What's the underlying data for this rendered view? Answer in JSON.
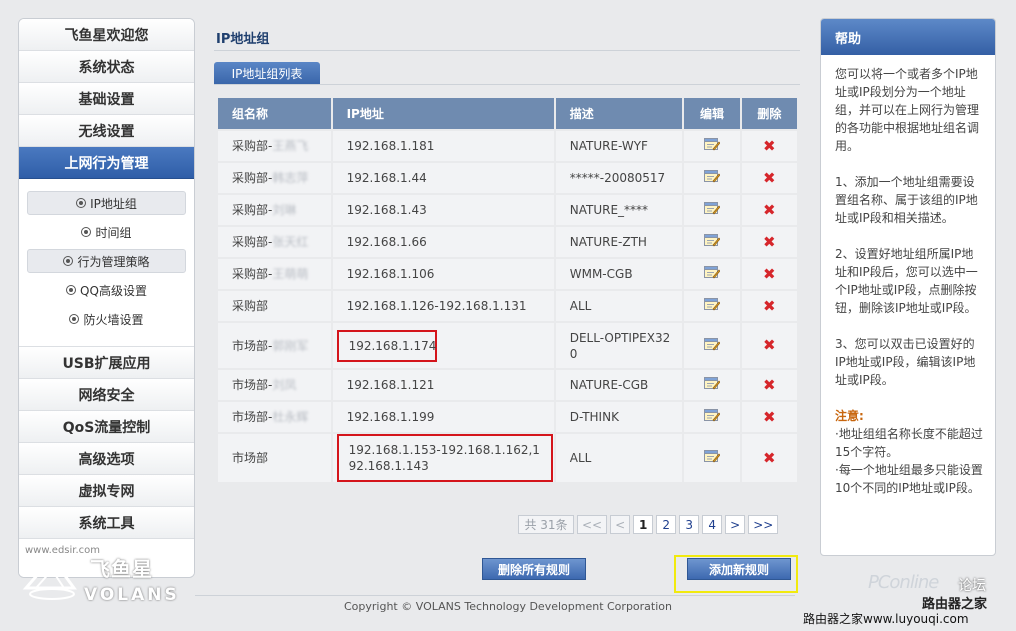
{
  "sidebar": {
    "items_top": [
      {
        "label": "飞鱼星欢迎您"
      },
      {
        "label": "系统状态"
      },
      {
        "label": "基础设置"
      },
      {
        "label": "无线设置"
      },
      {
        "label": "上网行为管理"
      }
    ],
    "submenu": [
      {
        "label": "IP地址组"
      },
      {
        "label": "时间组"
      },
      {
        "label": "行为管理策略"
      },
      {
        "label": "QQ高级设置"
      },
      {
        "label": "防火墙设置"
      }
    ],
    "items_bottom": [
      {
        "label": "USB扩展应用"
      },
      {
        "label": "网络安全"
      },
      {
        "label": "QoS流量控制"
      },
      {
        "label": "高级选项"
      },
      {
        "label": "虚拟专网"
      },
      {
        "label": "系统工具"
      }
    ],
    "footer_watermark": "www.edsir.com",
    "logo_text": "飞鱼星",
    "logo_sub": "VOLANS"
  },
  "main": {
    "title": "IP地址组",
    "tab": "IP地址组列表",
    "columns": [
      "组名称",
      "IP地址",
      "描述",
      "编辑",
      "删除"
    ],
    "rows": [
      {
        "name": "采购部-",
        "blurred": "王燕飞",
        "ip": "192.168.1.181",
        "desc": "NATURE-WYF"
      },
      {
        "name": "采购部-",
        "blurred": "韩志萍",
        "ip": "192.168.1.44",
        "desc": "*****-20080517"
      },
      {
        "name": "采购部-",
        "blurred": "刘琳",
        "ip": "192.168.1.43",
        "desc": "NATURE_****"
      },
      {
        "name": "采购部-",
        "blurred": "张天红",
        "ip": "192.168.1.66",
        "desc": "NATURE-ZTH"
      },
      {
        "name": "采购部-",
        "blurred": "王萌萌",
        "ip": "192.168.1.106",
        "desc": "WMM-CGB"
      },
      {
        "name": "采购部",
        "blurred": "",
        "ip": "192.168.1.126-192.168.1.131",
        "desc": "ALL"
      },
      {
        "name": "市场部-",
        "blurred": "郭刚军",
        "ip": "192.168.1.174",
        "desc": "DELL-OPTIPEX320"
      },
      {
        "name": "市场部-",
        "blurred": "刘凤",
        "ip": "192.168.1.121",
        "desc": "NATURE-CGB"
      },
      {
        "name": "市场部-",
        "blurred": "杜永辉",
        "ip": "192.168.1.199",
        "desc": "D-THINK"
      },
      {
        "name": "市场部",
        "blurred": "",
        "ip": "192.168.1.153-192.168.1.162,192.168.1.143",
        "desc": "ALL"
      }
    ],
    "pager": {
      "total": "共 31条",
      "first": "<<",
      "prev": "<",
      "pages": [
        "1",
        "2",
        "3",
        "4"
      ],
      "next": ">",
      "last": ">>"
    },
    "delete_all": "删除所有规则",
    "add_new": "添加新规则",
    "copyright": "Copyright © VOLANS Technology Development Corporation"
  },
  "help": {
    "title": "帮助",
    "paragraphs": [
      "您可以将一个或者多个IP地址或IP段划分为一个地址组，并可以在上网行为管理的各功能中根据地址组名调用。",
      "1、添加一个地址组需要设置组名称、属于该组的IP地址或IP段和相关描述。",
      "2、设置好地址组所属IP地址和IP段后，您可以选中一个IP地址或IP段，点删除按钮，删除该IP地址或IP段。",
      "3、您可以双击已设置好的IP地址或IP段，编辑该IP地址或IP段。"
    ],
    "note_title": "注意:",
    "notes": [
      "·地址组组名称长度不能超过15个字符。",
      "·每一个地址组最多只能设置10个不同的IP地址或IP段。"
    ]
  },
  "watermarks": {
    "pconline": "PConline",
    "forum": "论坛",
    "router": "路由器之家",
    "url": "路由器之家www.luyouqi.com"
  }
}
